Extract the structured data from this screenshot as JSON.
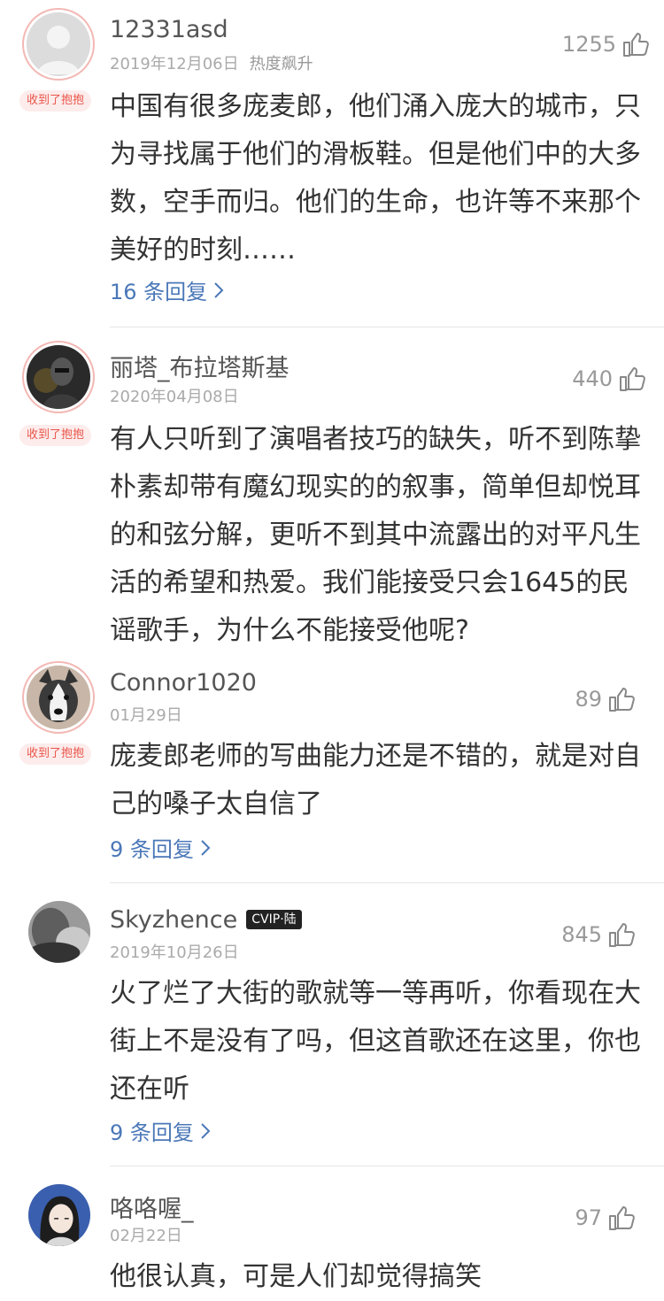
{
  "comments": [
    {
      "username": "12331asd",
      "date": "2019年12月06日",
      "tag": "热度飙升",
      "likes": "1255",
      "badge": "收到了抱抱",
      "text": "中国有很多庞麦郎，他们涌入庞大的城市，只为寻找属于他们的滑板鞋。但是他们中的大多数，空手而归。他们的生命，也许等不来那个美好的时刻……",
      "replies": "16 条回复",
      "avatar": "default-user-avatar"
    },
    {
      "username": "丽塔_布拉塔斯基",
      "date": "2020年04月08日",
      "likes": "440",
      "badge": "收到了抱抱",
      "text": "有人只听到了演唱者技巧的缺失，听不到陈挚朴素却带有魔幻现实的的叙事，简单但却悦耳的和弦分解，更听不到其中流露出的对平凡生活的希望和热爱。我们能接受只会1645的民谣歌手，为什么不能接受他呢?",
      "avatar": "dark-figure-avatar"
    },
    {
      "username": "Connor1020",
      "date": "01月29日",
      "likes": "89",
      "badge": "收到了抱抱",
      "text": "庞麦郎老师的写曲能力还是不错的，就是对自己的嗓子太自信了",
      "replies": "9 条回复",
      "avatar": "husky-dog-avatar"
    },
    {
      "username": "Skyzhence",
      "vip": "CVIP·陆",
      "date": "2019年10月26日",
      "likes": "845",
      "text": "火了烂了大街的歌就等一等再听，你看现在大街上不是没有了吗，但这首歌还在这里，你也还在听",
      "replies": "9 条回复",
      "avatar": "blurry-photo-avatar"
    },
    {
      "username": "咯咯喔_",
      "date": "02月22日",
      "likes": "97",
      "text": "他很认真，可是人们却觉得搞笑",
      "avatar": "anime-girl-avatar"
    }
  ]
}
